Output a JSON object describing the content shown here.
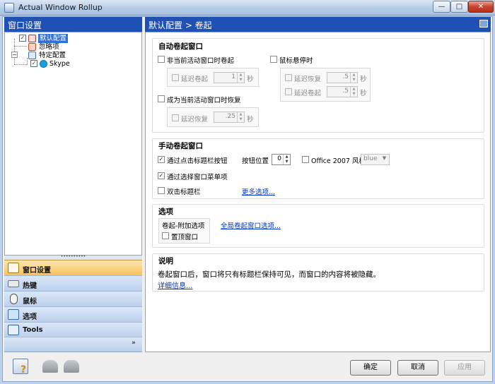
{
  "window": {
    "title": "Actual Window Rollup",
    "min_glyph": "—",
    "max_glyph": "□",
    "close_glyph": "✕"
  },
  "left": {
    "header": "窗口设置",
    "tree": [
      {
        "label": "默认配置",
        "checked": true,
        "selected": true
      },
      {
        "label": "忽略项",
        "checked": false
      },
      {
        "label": "特定配置",
        "checked": false
      },
      {
        "label": "Skype",
        "checked": true
      }
    ],
    "splitter_glyph": "••••••••••",
    "nav": [
      {
        "label": "窗口设置",
        "icon": "window-settings-icon"
      },
      {
        "label": "热键",
        "icon": "keyboard-icon"
      },
      {
        "label": "鼠标",
        "icon": "mouse-icon"
      },
      {
        "label": "选项",
        "icon": "options-icon"
      },
      {
        "label": "Tools",
        "icon": "tools-icon"
      }
    ],
    "more_glyph": "»"
  },
  "right": {
    "header": "默认配置 > 卷起",
    "auto": {
      "title": "自动卷起窗口",
      "inactive_label": "非当前活动窗口时卷起",
      "delay_rollup_label": "延迟卷起",
      "delay_rollup_value": "1",
      "restore_label": "成为当前活动窗口时恢复",
      "delay_restore_label": "延迟恢复",
      "delay_restore_value": ".25",
      "hover_label": "鼠标悬停时",
      "hover_restore_label": "延迟恢复",
      "hover_restore_value": ".5",
      "hover_rollup_label": "延迟卷起",
      "hover_rollup_value": ".5",
      "unit": "秒"
    },
    "manual": {
      "title": "手动卷起窗口",
      "titlebar_button_label": "通过点击标题栏按钮",
      "button_position_label": "按钮位置",
      "button_position_value": "0",
      "office_style_label": "Office 2007 风格",
      "office_style_value": "blue",
      "menu_item_label": "通过选择窗口菜单项",
      "double_click_label": "双击标题栏",
      "more_options_link": "更多选项..."
    },
    "options": {
      "title": "选项",
      "subgroup_label": "卷起-附加选项",
      "topmost_label": "置顶窗口",
      "global_link": "全局卷起窗口选项..."
    },
    "description": {
      "title": "说明",
      "text": "卷起窗口后，窗口将只有标题栏保持可见，而窗口的内容将被隐藏。",
      "link": "详细信息..."
    }
  },
  "buttons": {
    "ok": "确定",
    "cancel": "取消",
    "apply": "应用"
  },
  "check_glyph": "✓",
  "spin_glyph_up": "▲",
  "spin_glyph_down": "▼",
  "combo_glyph": "▼",
  "colors": {
    "header_blue": "#1e51b3",
    "nav_active": "#f8c25a",
    "link": "#0033cc"
  }
}
